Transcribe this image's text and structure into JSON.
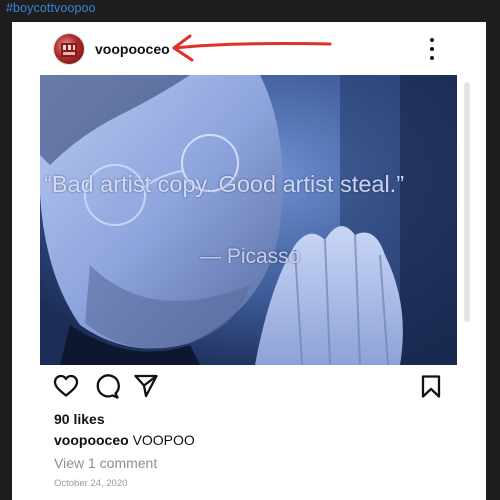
{
  "topbar": {
    "hashtag": "#boycottvoopoo"
  },
  "post": {
    "username": "voopooceo",
    "image": {
      "quote_text": "“Bad artist copy. Good artist steal.”",
      "quote_author": "— Picasso"
    },
    "likes": "90 likes",
    "caption_user": "voopooceo",
    "caption_text": "VOOPOO",
    "view_comments": "View 1 comment",
    "date": "October 24, 2020"
  },
  "icons": [
    "heart-icon",
    "comment-icon",
    "share-icon",
    "bookmark-icon",
    "more-options-icon"
  ],
  "colors": {
    "hashtag": "#3b82d6",
    "annotation_arrow": "#e0302a",
    "photo_tint": "#4a6fb0"
  }
}
